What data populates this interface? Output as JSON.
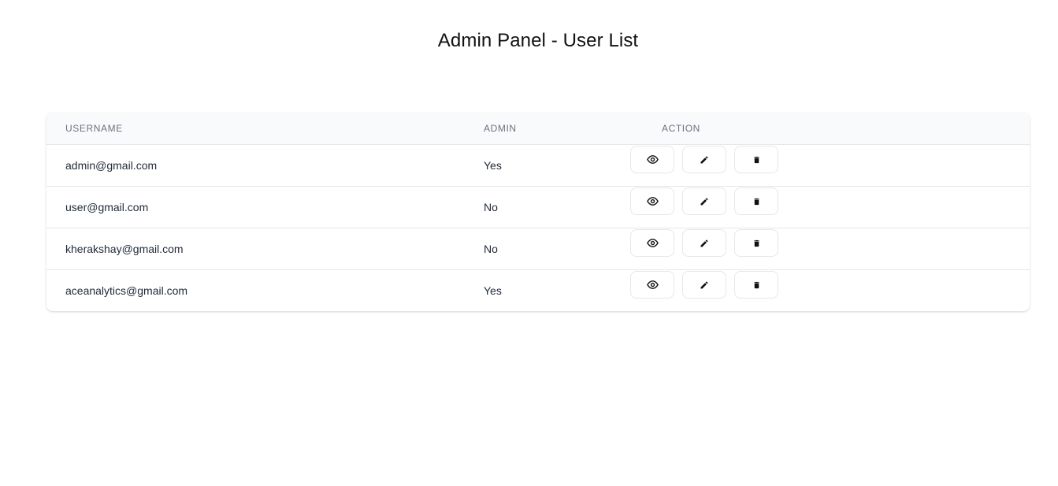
{
  "page": {
    "title": "Admin Panel - User List"
  },
  "table": {
    "headers": {
      "username": "USERNAME",
      "admin": "ADMIN",
      "action": "ACTION"
    },
    "rows": [
      {
        "username": "admin@gmail.com",
        "admin": "Yes"
      },
      {
        "username": "user@gmail.com",
        "admin": "No"
      },
      {
        "username": "kherakshay@gmail.com",
        "admin": "No"
      },
      {
        "username": "aceanalytics@gmail.com",
        "admin": "Yes"
      }
    ],
    "action_icons": [
      "eye-icon",
      "pencil-icon",
      "trash-icon"
    ]
  },
  "colors": {
    "header_bg": "#f9fafb",
    "border": "#e5e7eb",
    "header_text": "#6b7280",
    "body_text": "#1f2937"
  }
}
